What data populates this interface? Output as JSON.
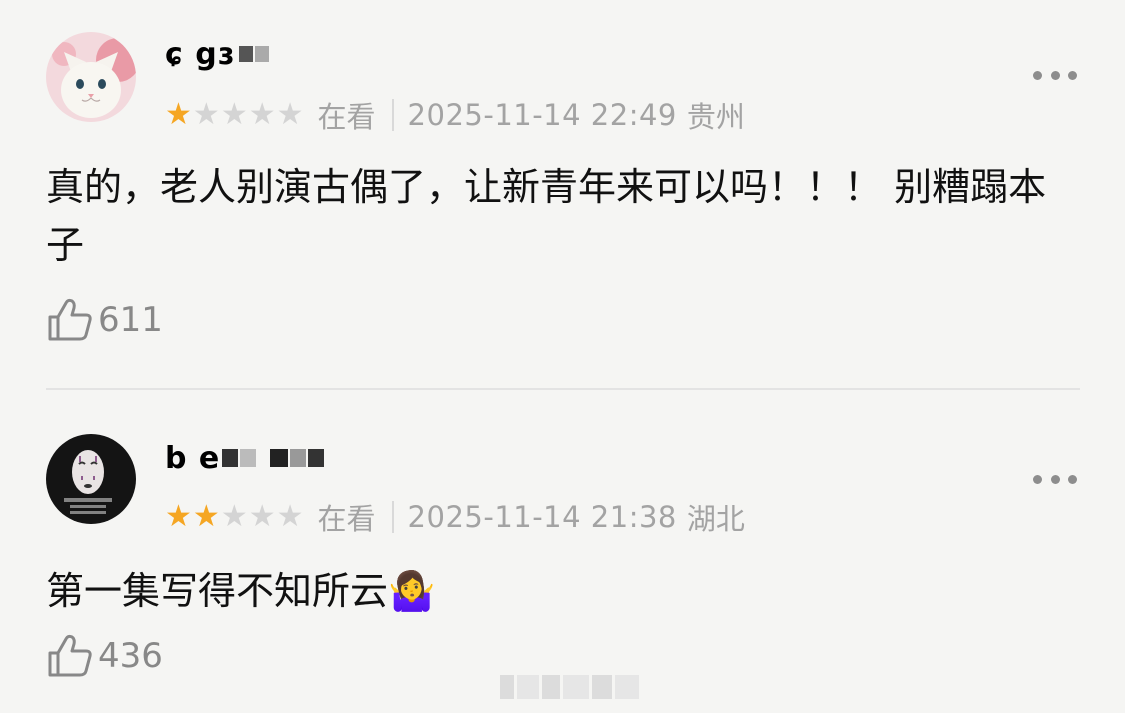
{
  "comments": [
    {
      "username": "ɕ  gɜ",
      "rating": 1,
      "max_rating": 5,
      "status": "在看",
      "datetime": "2025-11-14 22:49",
      "location": "贵州",
      "text": "真的，老人别演古偶了，让新青年来可以吗！！！ 别糟蹋本子",
      "likes": "611"
    },
    {
      "username": "b   e",
      "rating": 2,
      "max_rating": 5,
      "status": "在看",
      "datetime": "2025-11-14 21:38",
      "location": "湖北",
      "text": "第一集写得不知所云🤷‍♀️",
      "likes": "436"
    }
  ],
  "colors": {
    "star_on": "#f5a623",
    "star_off": "#d4d4d4",
    "meta_text": "#a3a3a3",
    "background": "#f5f5f3"
  },
  "icons": [
    "cat-avatar",
    "no-face-avatar",
    "star-icon",
    "more-icon",
    "thumbs-up-icon"
  ]
}
